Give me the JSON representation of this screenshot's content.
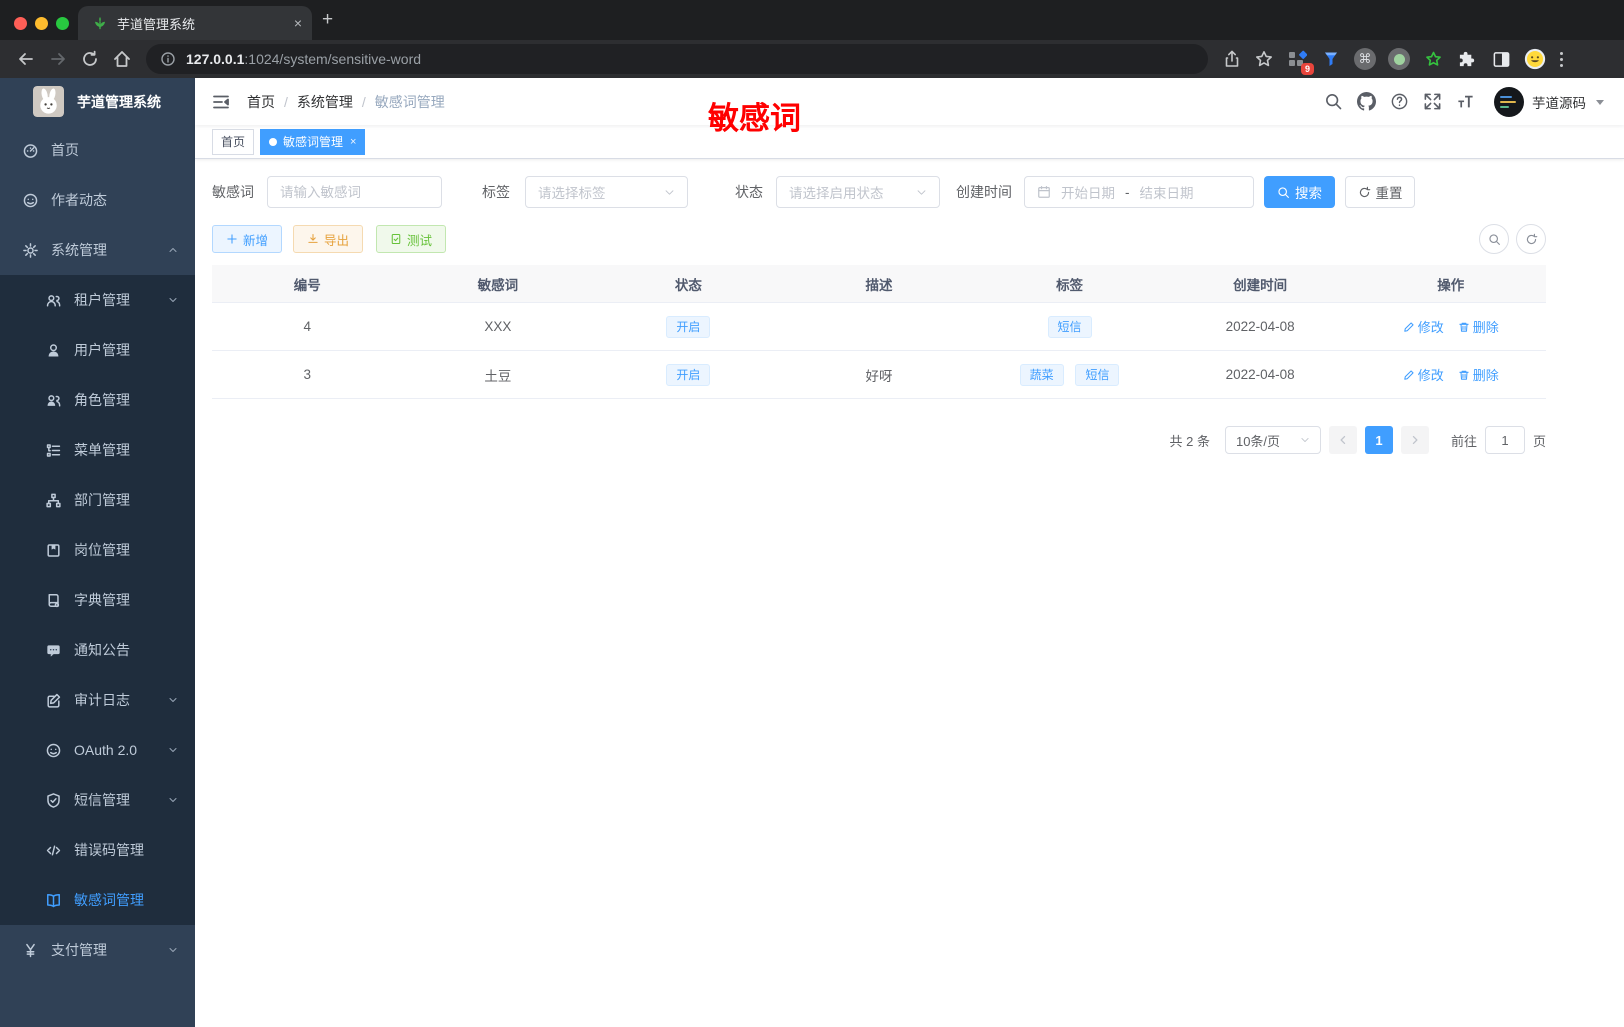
{
  "colors": {
    "accent": "#409eff",
    "annotation_red": "#ff0000",
    "warning": "#e6a23c",
    "success": "#67c23a",
    "sidebar_bg": "#304156",
    "submenu_bg": "#1f2d3d",
    "active_tab_bg": "#409eff"
  },
  "browser": {
    "tab_title": "芋道管理系统",
    "url_host": "127.0.0.1",
    "url_rest": ":1024/system/sensitive-word",
    "extension_badge": "9",
    "new_tab_plus": "+",
    "tab_close": "×"
  },
  "sidebar": {
    "app_title": "芋道管理系统",
    "items": [
      {
        "label": "首页",
        "icon": "dashboard-icon"
      },
      {
        "label": "作者动态",
        "icon": "author-icon"
      },
      {
        "label": "系统管理",
        "icon": "gear-icon"
      },
      {
        "label": "租户管理",
        "icon": "tenant-icon"
      },
      {
        "label": "用户管理",
        "icon": "user-icon"
      },
      {
        "label": "角色管理",
        "icon": "role-icon"
      },
      {
        "label": "菜单管理",
        "icon": "menu-tree-icon"
      },
      {
        "label": "部门管理",
        "icon": "dept-icon"
      },
      {
        "label": "岗位管理",
        "icon": "post-icon"
      },
      {
        "label": "字典管理",
        "icon": "dict-icon"
      },
      {
        "label": "通知公告",
        "icon": "notice-icon"
      },
      {
        "label": "审计日志",
        "icon": "audit-icon"
      },
      {
        "label": "OAuth 2.0",
        "icon": "oauth-icon"
      },
      {
        "label": "短信管理",
        "icon": "sms-shield-icon"
      },
      {
        "label": "错误码管理",
        "icon": "code-icon"
      },
      {
        "label": "敏感词管理",
        "icon": "open-book-icon"
      },
      {
        "label": "支付管理",
        "icon": "yen-icon"
      }
    ]
  },
  "header": {
    "breadcrumb": [
      "首页",
      "系统管理",
      "敏感词管理"
    ],
    "separator": "/",
    "user_name": "芋道源码",
    "annotation": "敏感词"
  },
  "tags_view": {
    "home_tab": "首页",
    "active_tab": "敏感词管理",
    "close": "×"
  },
  "filters": {
    "keyword_label": "敏感词",
    "keyword_placeholder": "请输入敏感词",
    "tag_label": "标签",
    "tag_placeholder": "请选择标签",
    "status_label": "状态",
    "status_placeholder": "请选择启用状态",
    "time_label": "创建时间",
    "time_start_placeholder": "开始日期",
    "time_separator": "-",
    "time_end_placeholder": "结束日期",
    "search_label": "搜索",
    "reset_label": "重置"
  },
  "toolbar": {
    "add_label": "新增",
    "export_label": "导出",
    "test_label": "测试"
  },
  "table": {
    "columns": [
      "编号",
      "敏感词",
      "状态",
      "描述",
      "标签",
      "创建时间",
      "操作"
    ],
    "edit_label": "修改",
    "delete_label": "删除",
    "rows": [
      {
        "id": "4",
        "word": "XXX",
        "status": "开启",
        "description": "",
        "tags": [
          "短信"
        ],
        "create_time": "2022-04-08"
      },
      {
        "id": "3",
        "word": "土豆",
        "status": "开启",
        "description": "好呀",
        "tags": [
          "蔬菜",
          "短信"
        ],
        "create_time": "2022-04-08"
      }
    ]
  },
  "pagination": {
    "total_text": "共 2 条",
    "page_size": "10条/页",
    "current_page": "1",
    "goto_label": "前往",
    "goto_value": "1",
    "page_unit": "页"
  }
}
